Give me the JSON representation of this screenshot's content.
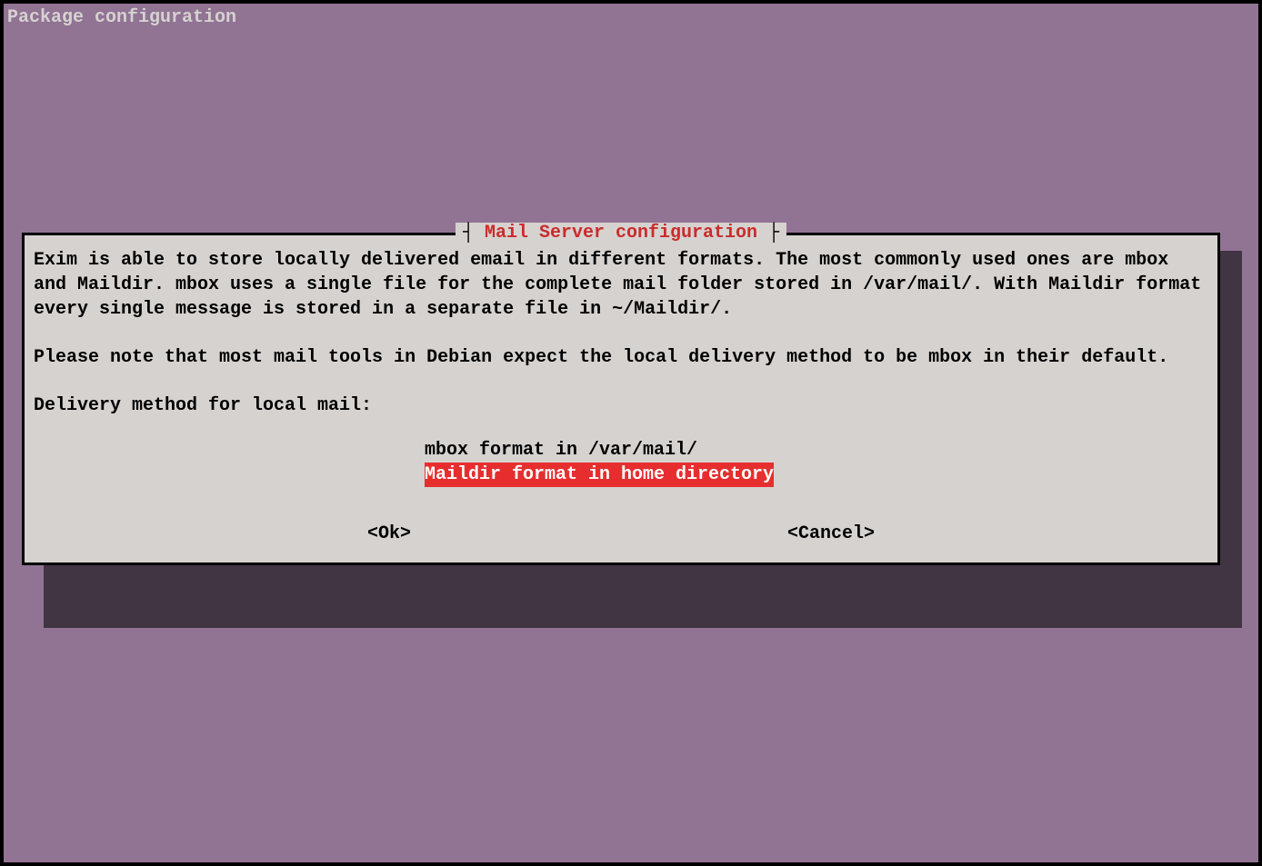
{
  "header": "Package configuration",
  "dialog": {
    "title": "Mail Server configuration",
    "paragraph1": "Exim is able to store locally delivered email in different formats. The most commonly used ones are mbox and Maildir. mbox uses a single file for the complete mail folder stored in /var/mail/. With Maildir format every single message is stored in a separate file in ~/Maildir/.",
    "paragraph2": "Please note that most mail tools in Debian expect the local delivery method to be mbox in their default.",
    "prompt": "Delivery method for local mail:",
    "options": [
      {
        "label": "mbox format in /var/mail/",
        "selected": false
      },
      {
        "label": "Maildir format in home directory",
        "selected": true
      }
    ],
    "ok_label": "<Ok>",
    "cancel_label": "<Cancel>"
  }
}
